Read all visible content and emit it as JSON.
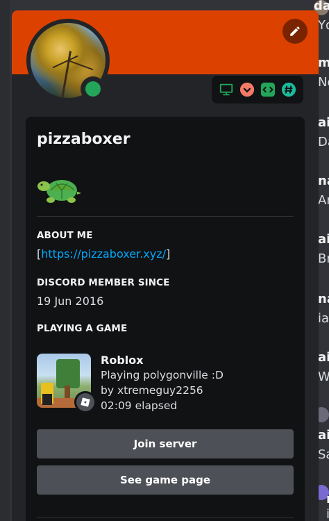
{
  "background_chat": {
    "lines": [
      {
        "text": "da",
        "bold": true
      },
      {
        "text": "Yd",
        "bold": false
      },
      {
        "text": "ma",
        "bold": true
      },
      {
        "text": "No",
        "bold": false
      },
      {
        "text": "ai",
        "bold": true
      },
      {
        "text": "Da",
        "bold": false
      },
      {
        "text": "na",
        "bold": true
      },
      {
        "text": "An",
        "bold": false
      },
      {
        "text": "ai",
        "bold": true
      },
      {
        "text": "Bru",
        "bold": false
      },
      {
        "text": "na",
        "bold": true
      },
      {
        "text": "ial",
        "bold": false
      },
      {
        "text": "ai",
        "bold": true
      },
      {
        "text": "Wo",
        "bold": false
      },
      {
        "text": "ai",
        "bold": true
      },
      {
        "text": "Sa",
        "bold": false
      },
      {
        "text": "na",
        "bold": true
      },
      {
        "text": "i",
        "bold": false
      }
    ]
  },
  "profile": {
    "username": "pizzaboxer",
    "status": "online",
    "bio_emoji": "turtle",
    "badges": [
      "desktop-badge-icon",
      "chevron-badge-icon",
      "code-badge-icon",
      "hash-badge-icon"
    ],
    "about_me": {
      "title": "ABOUT ME",
      "bracket_open": "[",
      "link": "https://pizzaboxer.xyz/",
      "bracket_close": "]"
    },
    "member_since": {
      "title": "DISCORD MEMBER SINCE",
      "date": "19 Jun 2016"
    },
    "activity": {
      "title": "PLAYING A GAME",
      "game": "Roblox",
      "details": "Playing polygonville :D",
      "state": "by xtremeguy2256",
      "elapsed": "02:09 elapsed"
    },
    "buttons": {
      "join": "Join server",
      "game_page": "See game page"
    }
  },
  "colors": {
    "banner": "#dc4100",
    "status_online": "#23a55a",
    "link": "#00a8fc",
    "button": "#4e5058"
  }
}
